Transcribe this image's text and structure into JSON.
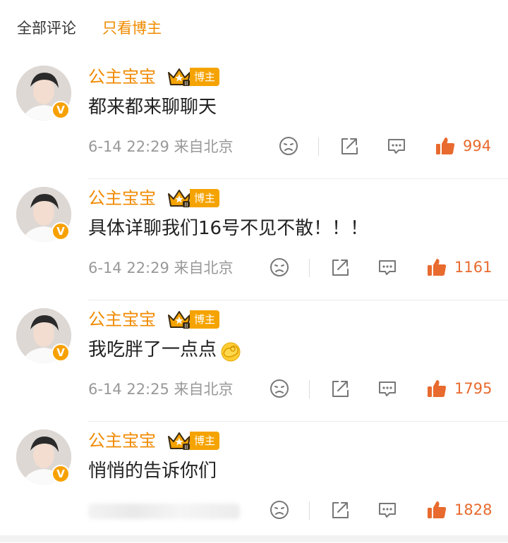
{
  "tabs": {
    "all": "全部评论",
    "blogger_only": "只看博主"
  },
  "colors": {
    "accent": "#f08a00",
    "badge": "#f5a300",
    "like": "#e86a2e",
    "meta": "#999999"
  },
  "comments": [
    {
      "user": "公主宝宝",
      "badge": "博主",
      "text": "都来都来聊聊天",
      "time": "6-14 22:29",
      "location": "来自北京",
      "likes": "994"
    },
    {
      "user": "公主宝宝",
      "badge": "博主",
      "text": "具体详聊我们16号不见不散！！！",
      "time": "6-14 22:29",
      "location": "来自北京",
      "likes": "1161"
    },
    {
      "user": "公主宝宝",
      "badge": "博主",
      "text": "我吃胖了一点点",
      "emoji": "pinch-hand-emoji",
      "time": "6-14 22:25",
      "location": "来自北京",
      "likes": "1795"
    },
    {
      "user": "公主宝宝",
      "badge": "博主",
      "text": "悄悄的告诉你们",
      "time": "",
      "location": "",
      "likes": "1828"
    }
  ]
}
